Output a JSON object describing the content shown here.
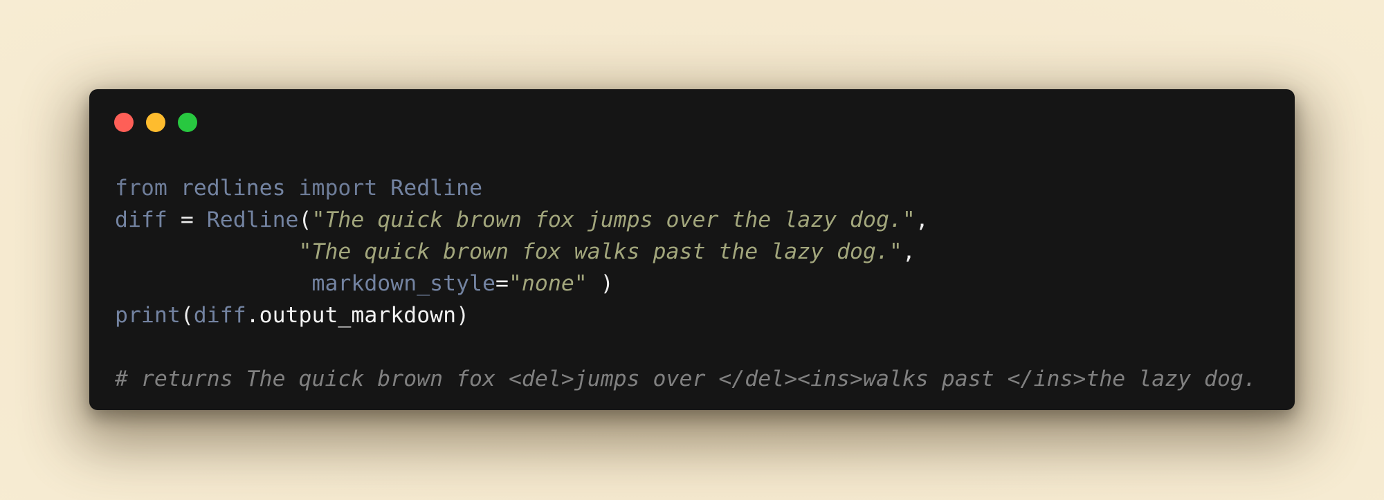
{
  "window": {
    "controls": {
      "close_color": "#fe5f57",
      "minimize_color": "#febc2e",
      "maximize_color": "#28c840"
    }
  },
  "colors": {
    "background": "#f5e9ce",
    "editor_bg": "#151515",
    "keyword": "#6e7d99",
    "string": "#a2a67c",
    "comment": "#808080",
    "plain": "#f0f0f0"
  },
  "code": {
    "line1": {
      "kw_from": "from",
      "module": "redlines",
      "kw_import": "import",
      "name": "Redline"
    },
    "line2": {
      "var": "diff",
      "eq": " = ",
      "cls": "Redline",
      "paren": "(",
      "arg1": "\"The quick brown fox jumps over the lazy dog.\"",
      "comma": ","
    },
    "line3": {
      "arg2": "\"The quick brown fox walks past the lazy dog.\"",
      "comma": ","
    },
    "line4": {
      "kwarg": "markdown_style",
      "eq": "=",
      "value": "\"none\"",
      "close": " )"
    },
    "line5": {
      "fn": "print",
      "open": "(",
      "var": "diff",
      "attr": ".output_markdown",
      "close": ")"
    },
    "comment": "# returns The quick brown fox <del>jumps over </del><ins>walks past </ins>the lazy dog."
  }
}
